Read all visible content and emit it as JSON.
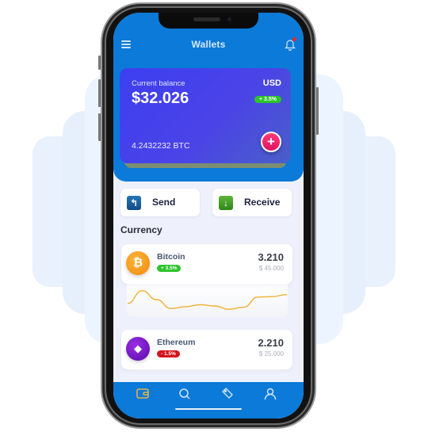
{
  "app": {
    "title": "Wallets",
    "notification_has_unread": true
  },
  "balance_card": {
    "label": "Current balance",
    "amount": "$32.026",
    "currency": "USD",
    "change": "+ 3.5%",
    "btc_amount": "4.2432232 BTC",
    "add_button": "+"
  },
  "actions": [
    {
      "label": "Send",
      "icon": "send-arrow-up-icon",
      "glyph": "↰"
    },
    {
      "label": "Receive",
      "icon": "receive-arrow-down-icon",
      "glyph": "↓"
    }
  ],
  "currency_section": {
    "title": "Currency",
    "coins": [
      {
        "name": "Bitcoin",
        "symbol_glyph": "₿",
        "change": "+ 3.5%",
        "trend": "up",
        "amount": "3.210",
        "usd_value": "$ 45.000"
      },
      {
        "name": "Ethereum",
        "symbol_glyph": "◆",
        "change": "- 1.5%",
        "trend": "down",
        "amount": "2.210",
        "usd_value": "$ 25.000"
      }
    ]
  },
  "bitcoin_sparkline": {
    "values": [
      0.35,
      0.85,
      0.5,
      0.15,
      0.22,
      0.3,
      0.25,
      0.12,
      0.2,
      0.6,
      0.62,
      0.7
    ],
    "color": "#f0b030"
  },
  "tabbar": {
    "tabs": [
      {
        "name": "wallet",
        "active": true
      },
      {
        "name": "search",
        "active": false
      },
      {
        "name": "tag",
        "active": false
      },
      {
        "name": "profile",
        "active": false
      }
    ],
    "active_color": "#e5b24a",
    "inactive_color": "#d4e6fb"
  },
  "colors": {
    "primary": "#0b7ad8",
    "card_gradient_start": "#3d3ff0",
    "positive": "#2cc42c",
    "negative": "#d4141c",
    "add_button": "#e0115e"
  }
}
